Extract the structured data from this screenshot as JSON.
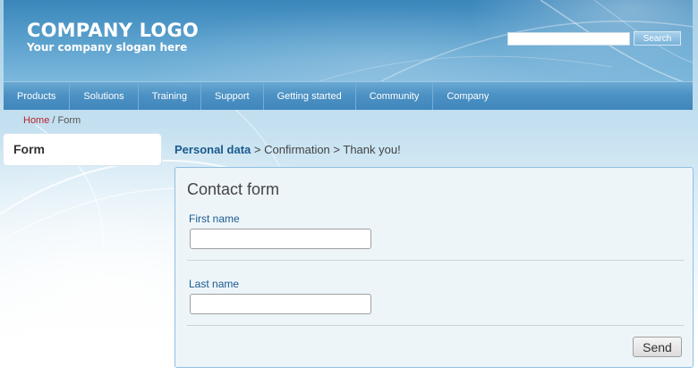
{
  "header": {
    "logo_text": "COMPANY LOGO",
    "slogan": "Your company slogan here",
    "search": {
      "value": "",
      "placeholder": "",
      "button_label": "Search"
    }
  },
  "nav": {
    "items": [
      {
        "label": "Products"
      },
      {
        "label": "Solutions"
      },
      {
        "label": "Training"
      },
      {
        "label": "Support"
      },
      {
        "label": "Getting started"
      },
      {
        "label": "Community"
      },
      {
        "label": "Company"
      }
    ]
  },
  "breadcrumb": {
    "home_label": "Home",
    "separator": " / ",
    "current_label": "Form"
  },
  "sidebar": {
    "title": "Form"
  },
  "steps": {
    "active": "Personal data",
    "separator": " > ",
    "step2": "Confirmation",
    "step3": "Thank you!"
  },
  "form": {
    "title": "Contact form",
    "fields": [
      {
        "label": "First name",
        "value": ""
      },
      {
        "label": "Last name",
        "value": ""
      }
    ],
    "submit_label": "Send"
  },
  "colors": {
    "header_blue": "#3a86bb",
    "nav_blue": "#4d92c4",
    "link_red": "#b3262d",
    "label_blue": "#1a5a8e",
    "panel_bg": "#edf5f9",
    "panel_border": "#8fbfe0"
  }
}
